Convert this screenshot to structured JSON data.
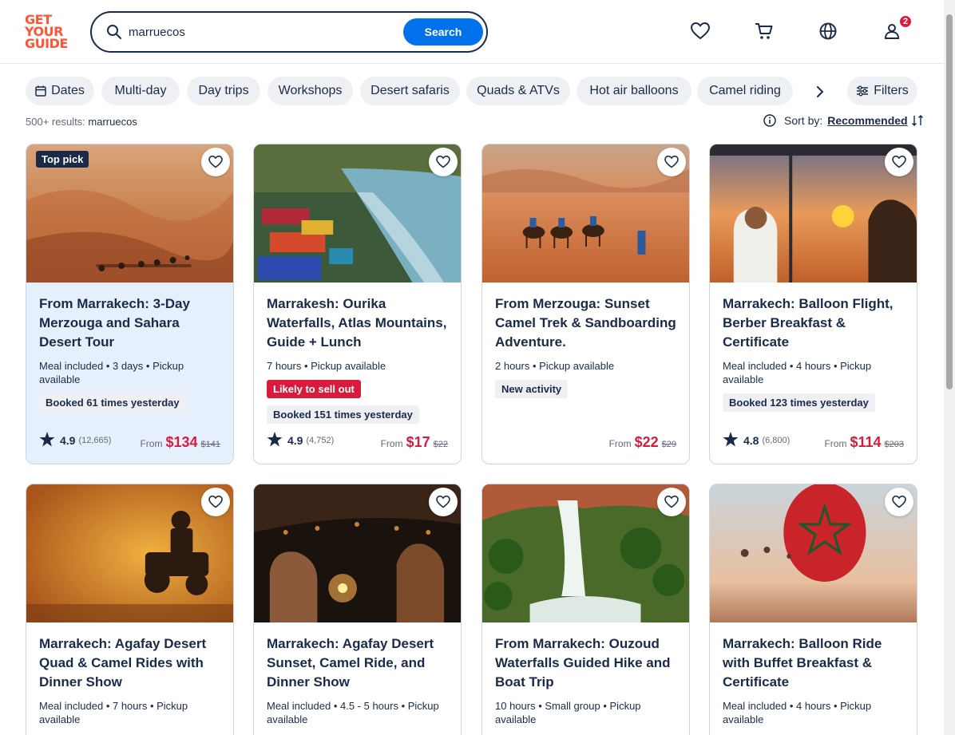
{
  "logo": {
    "line1": "GET",
    "line2": "YOUR",
    "line3": "GUIDE"
  },
  "search": {
    "value": "marruecos",
    "button": "Search"
  },
  "header": {
    "notification_count": "2"
  },
  "chips": [
    "Dates",
    "Multi-day",
    "Day trips",
    "Workshops",
    "Desert safaris",
    "Quads & ATVs",
    "Hot air balloons",
    "Camel riding"
  ],
  "filters_label": "Filters",
  "results": {
    "count": "500+ results:",
    "query": "marruecos"
  },
  "sort": {
    "label": "Sort by:",
    "value": "Recommended"
  },
  "cards": [
    {
      "title": "From Marrakech: 3-Day Merzouga and Sahara Desert Tour",
      "meta": "Meal included • 3 days • Pickup available",
      "top_pick": "Top pick",
      "booked": "Booked 61 times yesterday",
      "rating": "4.9",
      "reviews": "(12,665)",
      "from": "From",
      "price": "$134",
      "old_price": "$141"
    },
    {
      "title": "Marrakesh: Ourika Waterfalls, Atlas Mountains, Guide + Lunch",
      "meta": "7 hours • Pickup available",
      "likely": "Likely to sell out",
      "booked": "Booked 151 times yesterday",
      "rating": "4.9",
      "reviews": "(4,752)",
      "from": "From",
      "price": "$17",
      "old_price": "$22"
    },
    {
      "title": "From Merzouga: Sunset Camel Trek & Sandboarding Adventure.",
      "meta": "2 hours • Pickup available",
      "new": "New activity",
      "from": "From",
      "price": "$22",
      "old_price": "$29"
    },
    {
      "title": "Marrakech: Balloon Flight, Berber Breakfast & Certificate",
      "meta": "Meal included • 4 hours • Pickup available",
      "booked": "Booked 123 times yesterday",
      "rating": "4.8",
      "reviews": "(6,800)",
      "from": "From",
      "price": "$114",
      "old_price": "$203"
    },
    {
      "title": "Marrakech: Agafay Desert Quad & Camel Rides with Dinner Show",
      "meta": "Meal included • 7 hours • Pickup available"
    },
    {
      "title": "Marrakech: Agafay Desert Sunset, Camel Ride, and Dinner Show",
      "meta": "Meal included • 4.5 - 5 hours • Pickup available"
    },
    {
      "title": "From Marrakech: Ouzoud Waterfalls Guided Hike and Boat Trip",
      "meta": "10 hours • Small group • Pickup available"
    },
    {
      "title": "Marrakech: Balloon Ride with Buffet Breakfast & Certificate",
      "meta": "Meal included • 4 hours • Pickup available"
    }
  ],
  "colors": {
    "brand": "#ff5533",
    "primary": "#0071eb",
    "price": "#d81b3c",
    "text": "#1a2b49"
  }
}
